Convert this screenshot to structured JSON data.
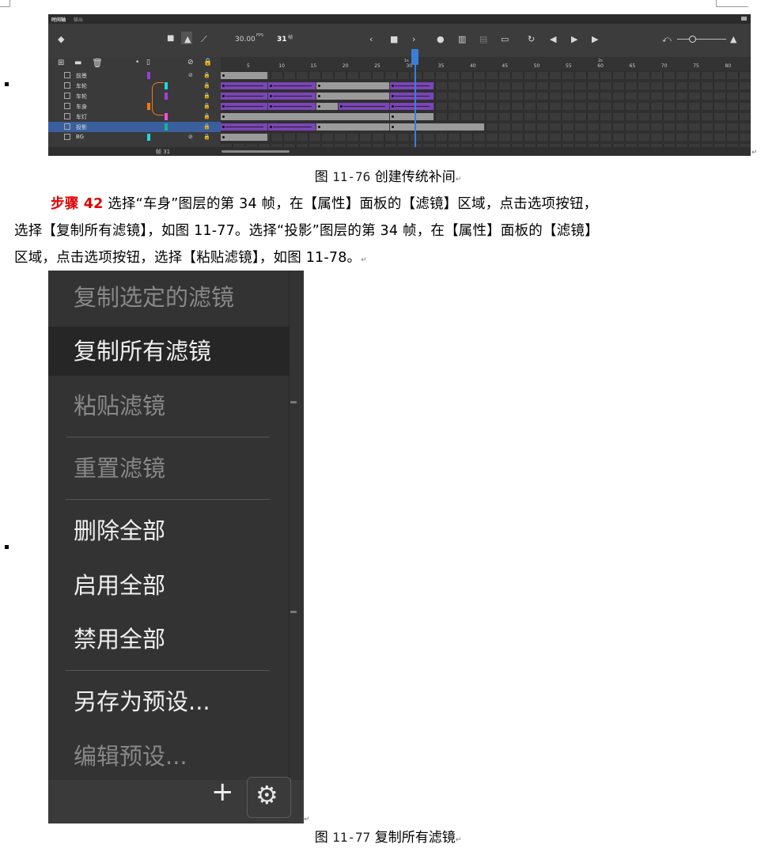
{
  "page": {
    "return_mark": "↵"
  },
  "figure_76": {
    "tabs": [
      "时间轴",
      "输出"
    ],
    "fps": "30.00",
    "fps_unit": "FPS",
    "frame_no": "31",
    "frame_unit": "帧",
    "ruler_seconds": [
      "1s",
      "2s"
    ],
    "ruler_ticks": [
      "5",
      "10",
      "15",
      "20",
      "25",
      "30",
      "35",
      "40",
      "45",
      "50",
      "55",
      "60",
      "65",
      "70",
      "75",
      "80"
    ],
    "layers": [
      {
        "name": "前景",
        "color": "#9a3fd0",
        "eye_off": true
      },
      {
        "name": "车轮",
        "color": "#1fd6e0",
        "eye_off": false
      },
      {
        "name": "车轮",
        "color": "#a040d8",
        "eye_off": false
      },
      {
        "name": "车身",
        "color": "#f07a12",
        "eye_off": false
      },
      {
        "name": "车灯",
        "color": "#f050e0",
        "eye_off": false
      },
      {
        "name": "投影",
        "color": "#12b890",
        "eye_off": false,
        "selected": true
      },
      {
        "name": "BG",
        "color": "#1fd6e0",
        "eye_off": true
      }
    ],
    "footer_frame": "帧 31",
    "caption_label": "图",
    "caption_num": "11-76",
    "caption_text": "创建传统补间"
  },
  "step": {
    "label": "步骤 42",
    "line1": "选择“车身”图层的第 34 帧，在【属性】面板的【滤镜】区域，点击选项按钮，",
    "line2": "选择【复制所有滤镜】，如图 11-77。选择“投影”图层的第 34 帧，在【属性】面板的【滤镜】",
    "line3": "区域，点击选项按钮，选择【粘贴滤镜】，如图 11-78。"
  },
  "figure_77": {
    "menu": [
      {
        "label": "复制选定的滤镜",
        "enabled": false
      },
      {
        "label": "复制所有滤镜",
        "enabled": true,
        "highlighted": true
      },
      {
        "label": "粘贴滤镜",
        "enabled": false
      },
      {
        "label": "重置滤镜",
        "enabled": false
      },
      {
        "label": "删除全部",
        "enabled": true
      },
      {
        "label": "启用全部",
        "enabled": true
      },
      {
        "label": "禁用全部",
        "enabled": true
      },
      {
        "label": "另存为预设...",
        "enabled": true
      },
      {
        "label": "编辑预设...",
        "enabled": false
      }
    ],
    "plus_icon": "+",
    "gear_icon": "⚙",
    "caption_label": "图",
    "caption_num": "11-77",
    "caption_text": "复制所有滤镜"
  }
}
